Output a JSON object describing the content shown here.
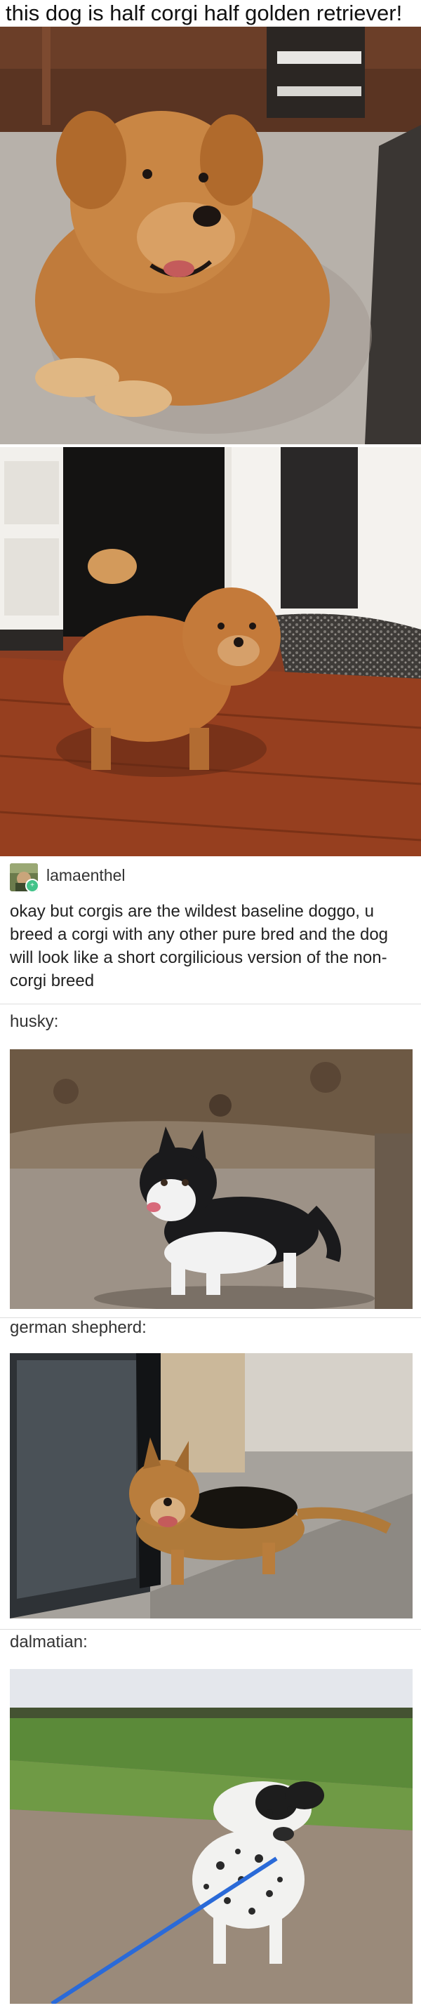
{
  "title": "this dog is half corgi half golden retriever!",
  "photos": {
    "golden_lying": {
      "alt": "half corgi half golden retriever dog lying on carpet"
    },
    "golden_standing": {
      "alt": "half corgi half golden retriever dog standing on wood floor"
    },
    "husky": {
      "alt": "husky corgi mix standing on dirt"
    },
    "shepherd": {
      "alt": "german shepherd corgi mix on sidewalk"
    },
    "dalmatian": {
      "alt": "dalmatian corgi mix on leash on path"
    }
  },
  "post": {
    "username": "lamaenthel",
    "text": "okay but corgis are the wildest baseline doggo, u breed a corgi with any other pure bred and the dog will look like a short corgilicious version of the non-corgi breed"
  },
  "labels": {
    "husky": "husky:",
    "shepherd": "german shepherd:",
    "dalmatian": "dalmatian:"
  }
}
